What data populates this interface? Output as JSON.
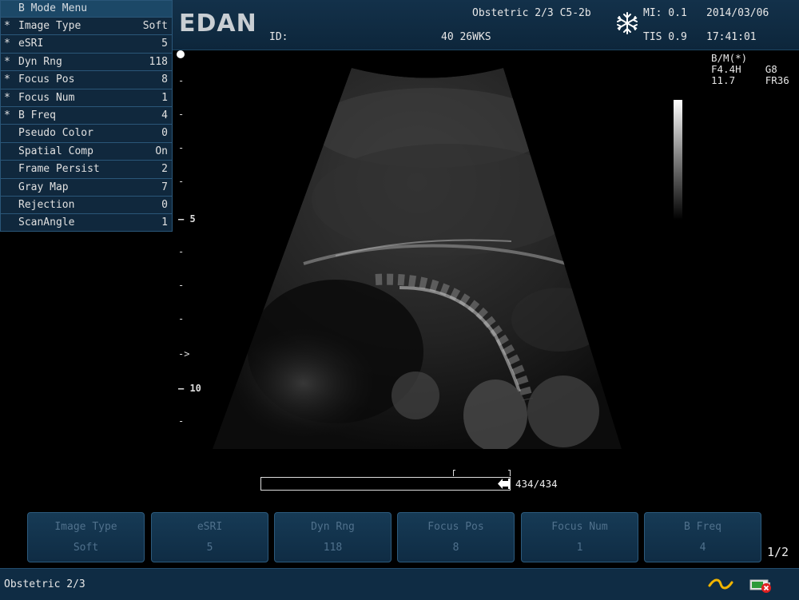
{
  "header": {
    "logo": "EDAN",
    "id_label": "ID:",
    "exam": "Obstetric 2/3 C5-2b",
    "gestational_age": "40 26WKS",
    "mi": "MI: 0.1",
    "tis": "TIS 0.9",
    "date": "2014/03/06",
    "time": "17:41:01",
    "freeze_icon": "snowflake-icon"
  },
  "menu": {
    "title": "B Mode Menu",
    "items": [
      {
        "star": "*",
        "label": "Image Type",
        "value": "Soft"
      },
      {
        "star": "*",
        "label": "eSRI",
        "value": "5"
      },
      {
        "star": "*",
        "label": "Dyn Rng",
        "value": "118"
      },
      {
        "star": "*",
        "label": "Focus Pos",
        "value": "8"
      },
      {
        "star": "*",
        "label": "Focus Num",
        "value": "1"
      },
      {
        "star": "*",
        "label": "B Freq",
        "value": "4"
      },
      {
        "star": "",
        "label": "Pseudo Color",
        "value": "0"
      },
      {
        "star": "",
        "label": "Spatial Comp",
        "value": "On"
      },
      {
        "star": "",
        "label": "Frame Persist",
        "value": "2"
      },
      {
        "star": "",
        "label": "Gray Map",
        "value": "7"
      },
      {
        "star": "",
        "label": "Rejection",
        "value": "0"
      },
      {
        "star": "",
        "label": "ScanAngle",
        "value": "1"
      }
    ]
  },
  "params": {
    "line1": "B/M(*)",
    "line2": "F4.4H    G8",
    "line3": "11.7     FR36"
  },
  "scale": {
    "label_5": "5",
    "label_10": "10",
    "focus_marker": "->"
  },
  "cine": {
    "count": "434/434",
    "progress": 1.0
  },
  "softkeys": [
    {
      "label": "Image Type",
      "value": "Soft"
    },
    {
      "label": "eSRI",
      "value": "5"
    },
    {
      "label": "Dyn Rng",
      "value": "118"
    },
    {
      "label": "Focus Pos",
      "value": "8"
    },
    {
      "label": "Focus Num",
      "value": "1"
    },
    {
      "label": "B Freq",
      "value": "4"
    }
  ],
  "page_indicator": "1/2",
  "footer": {
    "exam": "Obstetric 2/3",
    "power_icon": "ac-power-icon",
    "battery_icon": "battery-icon"
  },
  "colors": {
    "panel": "#0f2c44",
    "panel_border": "#2c5a7c",
    "softkey_text": "#50718c"
  }
}
